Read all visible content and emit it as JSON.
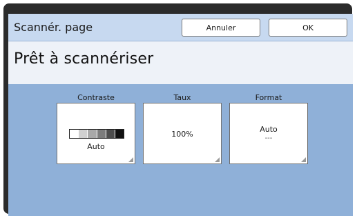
{
  "header": {
    "title": "Scannér. page",
    "cancel_label": "Annuler",
    "ok_label": "OK"
  },
  "status": {
    "message": "Prêt à scannériser"
  },
  "settings": {
    "contrast": {
      "label": "Contraste",
      "value": "Auto",
      "levels": [
        "#ffffff",
        "#d0d0d0",
        "#a8a8a8",
        "#7c7c7c",
        "#4d4d4d",
        "#111111"
      ]
    },
    "rate": {
      "label": "Taux",
      "value": "100%"
    },
    "format": {
      "label": "Format",
      "value": "Auto",
      "sub_value": "---"
    }
  },
  "colors": {
    "title_bar": "#c7d9f0",
    "status_bar": "#eef2f8",
    "panel_background": "#8fb0d8",
    "frame": "#2b2b2b"
  }
}
